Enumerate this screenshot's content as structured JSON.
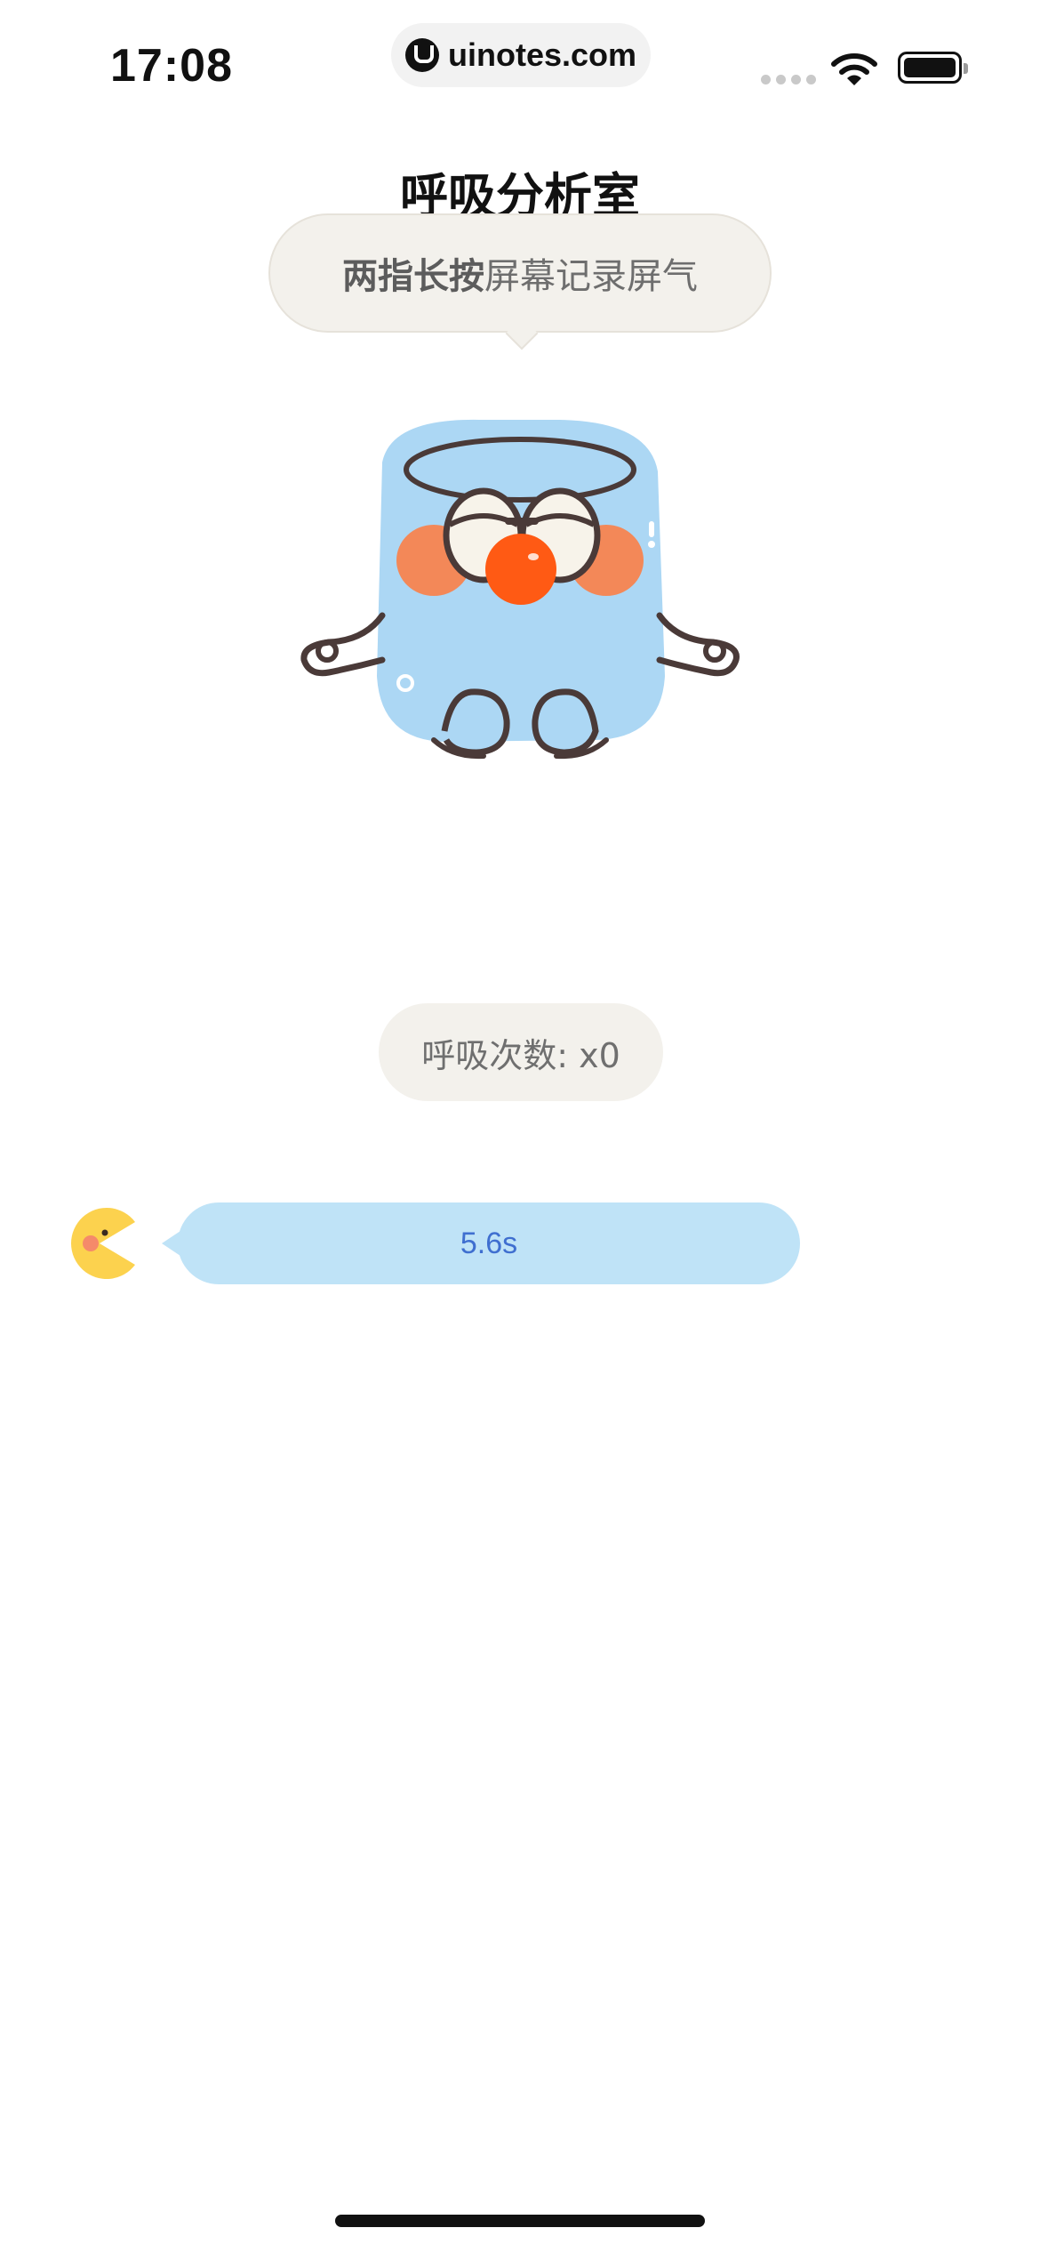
{
  "status_bar": {
    "time": "17:08",
    "url": "uinotes.com",
    "icons": [
      "signal-dots-icon",
      "wifi-icon",
      "battery-icon"
    ]
  },
  "page": {
    "title": "呼吸分析室"
  },
  "hint": {
    "strong": "两指长按",
    "rest": "屏幕记录屏气"
  },
  "counter": {
    "label": "呼吸次数: x0"
  },
  "timer": {
    "value": "5.6s",
    "avatar_icon": "pacman-chick-icon"
  },
  "colors": {
    "mascot_body": "#acd7f4",
    "mascot_nose": "#ff5a14",
    "bubble_bg": "#f3f1ec",
    "timer_bg": "#bfe3f7",
    "timer_text": "#3f6fd0",
    "avatar": "#fcd24e"
  }
}
